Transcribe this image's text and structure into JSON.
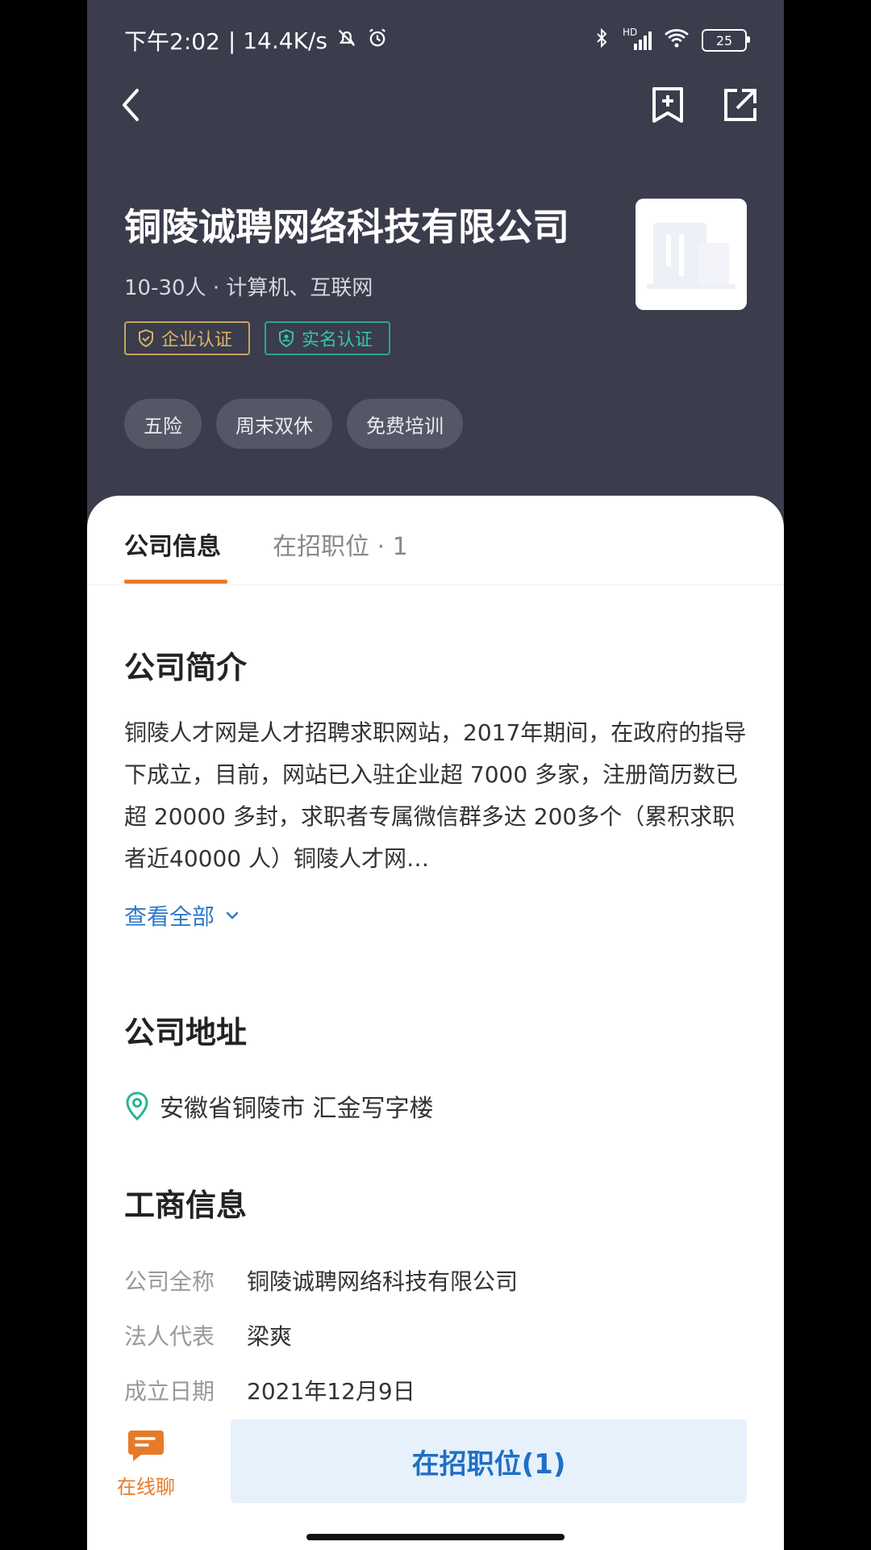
{
  "status_bar": {
    "time": "下午2:02",
    "network_speed": "| 14.4K/s",
    "network_type": "HD",
    "battery": "25"
  },
  "company": {
    "name": "铜陵诚聘网络科技有限公司",
    "meta": "10-30人 · 计算机、互联网",
    "badges": [
      "企业认证",
      "实名认证"
    ],
    "welfare": [
      "五险",
      "周末双休",
      "免费培训"
    ]
  },
  "tabs": {
    "info": "公司信息",
    "jobs": "在招职位 · 1"
  },
  "intro": {
    "title": "公司简介",
    "text": "铜陵人才网是人才招聘求职网站，2017年期间，在政府的指导下成立，目前，网站已入驻企业超 7000 多家，注册简历数已超 20000 多封，求职者专属微信群多达 200多个（累积求职者近40000 人）铜陵人才网…",
    "more": "查看全部"
  },
  "address": {
    "title": "公司地址",
    "text": "安徽省铜陵市 汇金写字楼"
  },
  "business": {
    "title": "工商信息",
    "rows": [
      {
        "label": "公司全称",
        "value": "铜陵诚聘网络科技有限公司"
      },
      {
        "label": "法人代表",
        "value": "梁爽"
      },
      {
        "label": "成立日期",
        "value": "2021年12月9日"
      }
    ]
  },
  "bottom": {
    "chat": "在线聊",
    "jobs_button": "在招职位(1)"
  },
  "colors": {
    "header_bg": "#3b3c4c",
    "accent_orange": "#e77a2a",
    "link_blue": "#2f79c8",
    "button_bg": "#e6f1fc"
  }
}
